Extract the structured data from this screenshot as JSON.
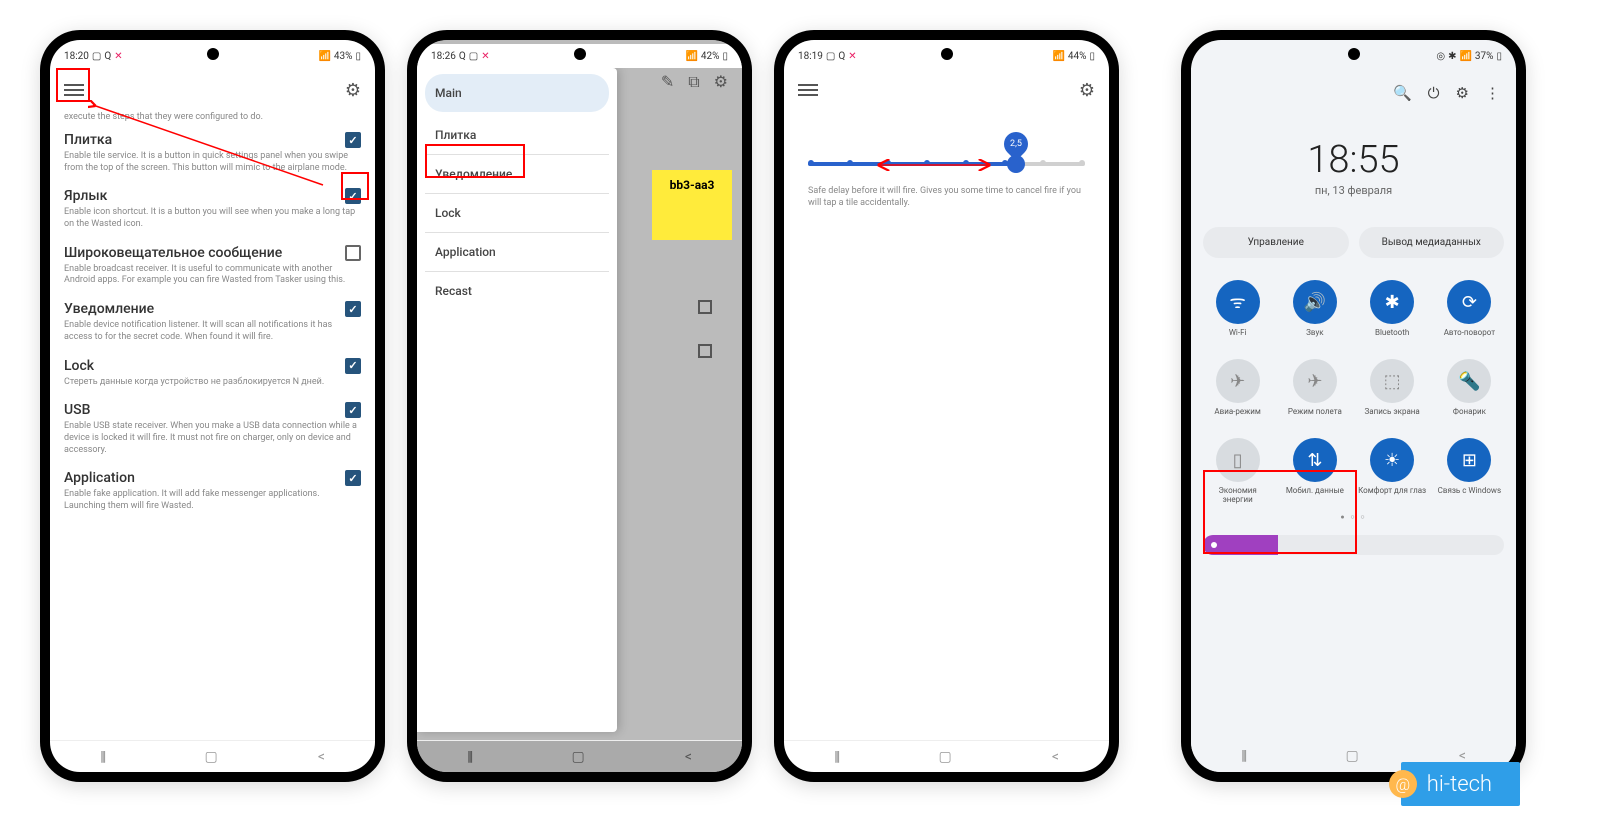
{
  "phone1": {
    "status": {
      "time": "18:20",
      "battery": "43%"
    },
    "truncated": "execute the steps that they were configured to do.",
    "settings": [
      {
        "title": "Плитка",
        "desc": "Enable tile service. It is a button in quick settings panel when you swipe from the top of the screen. This button will mimic to the airplane mode.",
        "checked": true
      },
      {
        "title": "Ярлык",
        "desc": "Enable icon shortcut. It is a button you will see when you make a long tap on the Wasted icon.",
        "checked": true
      },
      {
        "title": "Широковещательное сообщение",
        "desc": "Enable broadcast receiver. It is useful to communicate with another Android apps. For example you can fire Wasted from Tasker using this.",
        "checked": false
      },
      {
        "title": "Уведомление",
        "desc": "Enable device notification listener. It will scan all notifications it has access to for the secret code. When found it will fire.",
        "checked": true
      },
      {
        "title": "Lock",
        "desc": "Стереть данные когда устройство не разблокируется N дней.",
        "checked": true
      },
      {
        "title": "USB",
        "desc": "Enable USB state receiver. When you make a USB data connection while a device is locked it will fire. It must not fire on charger, only on device and accessory.",
        "checked": true
      },
      {
        "title": "Application",
        "desc": "Enable fake application. It will add fake messenger applications. Launching them will fire Wasted.",
        "checked": true
      }
    ]
  },
  "phone2": {
    "status": {
      "time": "18:26",
      "battery": "42%"
    },
    "drawer": [
      "Main",
      "Плитка",
      "Уведомление",
      "Lock",
      "Application",
      "Recast"
    ],
    "yellow_text": "bb3-aa3"
  },
  "phone3": {
    "status": {
      "time": "18:19",
      "battery": "44%"
    },
    "slider_value": "2,5",
    "slider_desc": "Safe delay before it will fire. Gives you some time to cancel fire if you will tap a tile accidentally."
  },
  "phone4": {
    "status": {
      "battery": "37%"
    },
    "time": "18:55",
    "date": "пн, 13 февраля",
    "buttons": [
      "Управление",
      "Вывод медиаданных"
    ],
    "tiles": [
      {
        "label": "Wi-Fi",
        "icon": "wifi",
        "on": true
      },
      {
        "label": "Звук",
        "icon": "sound",
        "on": true
      },
      {
        "label": "Bluetooth",
        "icon": "bt",
        "on": true
      },
      {
        "label": "Авто-поворот",
        "icon": "rotate",
        "on": true
      },
      {
        "label": "Авиа-режим",
        "icon": "plane",
        "on": false
      },
      {
        "label": "Режим полета",
        "icon": "plane",
        "on": false
      },
      {
        "label": "Запись экрана",
        "icon": "record",
        "on": false
      },
      {
        "label": "Фонарик",
        "icon": "torch",
        "on": false
      },
      {
        "label": "Экономия энергии",
        "icon": "battery",
        "on": false
      },
      {
        "label": "Мобил. данные",
        "icon": "data",
        "on": true
      },
      {
        "label": "Комфорт для глаз",
        "icon": "eye",
        "on": true
      },
      {
        "label": "Связь с Windows",
        "icon": "win",
        "on": true
      }
    ]
  },
  "watermark": "hi-tech"
}
